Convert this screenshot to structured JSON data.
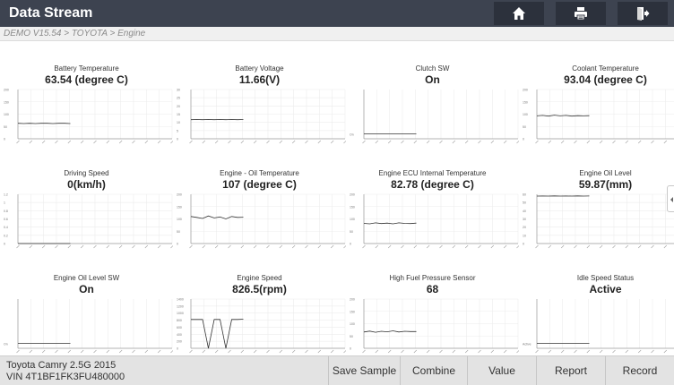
{
  "header": {
    "title": "Data Stream",
    "buttons": [
      {
        "name": "home-button",
        "icon": "home-icon"
      },
      {
        "name": "print-button",
        "icon": "printer-icon"
      },
      {
        "name": "exit-button",
        "icon": "exit-icon"
      }
    ]
  },
  "breadcrumb": "DEMO V15.54 > TOYOTA > Engine",
  "colors": {
    "header_bg": "#3d4350",
    "button_bg": "#2c313c",
    "bottom_bg": "#e3e3e3",
    "trace": "#333333"
  },
  "items": [
    {
      "name": "Battery Temperature",
      "value": "63.54 (degree C)",
      "chart": {
        "type": "line",
        "y_ticks": [
          "200",
          "150",
          "100",
          "50",
          "0"
        ],
        "ylim": [
          0,
          200
        ],
        "points": [
          63,
          62,
          63,
          62,
          63,
          63,
          62,
          63,
          63,
          62
        ]
      }
    },
    {
      "name": "Battery Voltage",
      "value": "11.66(V)",
      "chart": {
        "type": "line",
        "y_ticks": [
          "30",
          "25",
          "20",
          "15",
          "10",
          "5",
          "0"
        ],
        "ylim": [
          0,
          30
        ],
        "points": [
          11.6,
          11.7,
          11.6,
          11.7,
          11.6,
          11.7,
          11.6,
          11.7,
          11.6,
          11.7
        ]
      }
    },
    {
      "name": "Clutch SW",
      "value": "On",
      "chart": {
        "type": "line",
        "y_ticks": [
          "On"
        ],
        "ylim": [
          0,
          1
        ],
        "points": [
          0.1,
          0.1,
          0.1,
          0.1,
          0.1,
          0.1,
          0.1,
          0.1,
          0.1,
          0.1
        ]
      }
    },
    {
      "name": "Coolant Temperature",
      "value": "93.04 (degree C)",
      "chart": {
        "type": "line",
        "y_ticks": [
          "200",
          "150",
          "100",
          "50",
          "0"
        ],
        "ylim": [
          0,
          200
        ],
        "points": [
          93,
          95,
          92,
          96,
          93,
          95,
          92,
          94,
          93,
          94
        ]
      }
    },
    {
      "name": "Driving Speed",
      "value": "0(km/h)",
      "chart": {
        "type": "line",
        "y_ticks": [
          "1.2",
          "1",
          "0.8",
          "0.6",
          "0.4",
          "0.2",
          "0"
        ],
        "ylim": [
          0,
          1.2
        ],
        "points": [
          0,
          0,
          0,
          0,
          0,
          0,
          0,
          0,
          0,
          0
        ]
      }
    },
    {
      "name": "Engine - Oil Temperature",
      "value": "107 (degree C)",
      "chart": {
        "type": "line",
        "y_ticks": [
          "200",
          "150",
          "100",
          "50",
          "0"
        ],
        "ylim": [
          0,
          200
        ],
        "points": [
          110,
          106,
          102,
          112,
          104,
          108,
          100,
          110,
          106,
          107
        ]
      }
    },
    {
      "name": "Engine ECU Internal Temperature",
      "value": "82.78 (degree C)",
      "chart": {
        "type": "line",
        "y_ticks": [
          "200",
          "150",
          "100",
          "50",
          "0"
        ],
        "ylim": [
          0,
          200
        ],
        "points": [
          82,
          80,
          84,
          81,
          83,
          80,
          84,
          82,
          81,
          83
        ]
      }
    },
    {
      "name": "Engine Oil Level",
      "value": "59.87(mm)",
      "chart": {
        "type": "line",
        "y_ticks": [
          "60",
          "50",
          "40",
          "30",
          "20",
          "10",
          "0"
        ],
        "ylim": [
          0,
          62
        ],
        "points": [
          59.8,
          59.9,
          59.7,
          60,
          59.8,
          59.9,
          59.7,
          60,
          59.8,
          59.9
        ]
      }
    },
    {
      "name": "Engine Oil Level SW",
      "value": "On",
      "chart": {
        "type": "line",
        "y_ticks": [
          "On"
        ],
        "ylim": [
          0,
          1
        ],
        "points": [
          0.1,
          0.1,
          0.1,
          0.1,
          0.1,
          0.1,
          0.1,
          0.1,
          0.1,
          0.1
        ]
      }
    },
    {
      "name": "Engine Speed",
      "value": "826.5(rpm)",
      "chart": {
        "type": "line",
        "y_ticks": [
          "1400",
          "1200",
          "1000",
          "800",
          "600",
          "400",
          "200",
          "0"
        ],
        "ylim": [
          0,
          1400
        ],
        "points": [
          820,
          820,
          820,
          0,
          820,
          820,
          0,
          820,
          820,
          826
        ]
      }
    },
    {
      "name": "High Fuel Pressure Sensor",
      "value": "68",
      "chart": {
        "type": "line",
        "y_ticks": [
          "200",
          "150",
          "100",
          "50",
          "0"
        ],
        "ylim": [
          0,
          200
        ],
        "points": [
          66,
          70,
          65,
          69,
          67,
          71,
          66,
          69,
          68,
          68
        ]
      }
    },
    {
      "name": "Idle Speed Status",
      "value": "Active",
      "chart": {
        "type": "line",
        "y_ticks": [
          "Active"
        ],
        "ylim": [
          0,
          1
        ],
        "points": [
          0.1,
          0.1,
          0.1,
          0.1,
          0.1,
          0.1,
          0.1,
          0.1,
          0.1,
          0.1
        ]
      }
    }
  ],
  "vehicle": {
    "model": "Toyota Camry 2.5G 2015",
    "vin": "VIN 4T1BF1FK3FU480000"
  },
  "bottom_buttons": [
    "Save Sample",
    "Combine",
    "Value",
    "Report",
    "Record"
  ]
}
